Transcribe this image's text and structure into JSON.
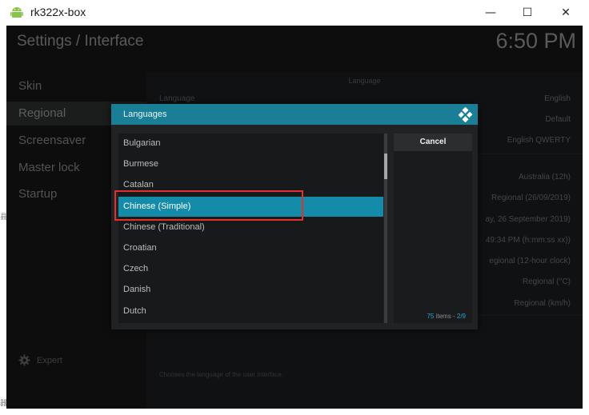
{
  "window": {
    "title": "rk322x-box",
    "minimize_glyph": "—",
    "maximize_glyph": "☐",
    "close_glyph": "✕",
    "app_icon": "android-icon"
  },
  "header": {
    "breadcrumb": "Settings / Interface",
    "clock": "6:50 PM"
  },
  "sidebar": {
    "items": [
      {
        "label": "Skin"
      },
      {
        "label": "Regional"
      },
      {
        "label": "Screensaver"
      },
      {
        "label": "Master lock"
      },
      {
        "label": "Startup"
      }
    ],
    "expert_label": "Expert",
    "expert_icon": "gear-icon"
  },
  "settings": {
    "section_header": "Language",
    "language_label": "Language",
    "language_value": "English",
    "charset_value": "Default",
    "keyboard_value": "English QWERTY",
    "region_value": "Australia (12h)",
    "short_date_value": "Regional (26/09/2019)",
    "long_date_value": "ay, 26 September 2019)",
    "time_format_value": "49:34 PM (h:mm:ss xx))",
    "clock_value": "egional (12-hour clock)",
    "temperature_value": "Regional (°C)",
    "speed_value": "Regional (km/h)",
    "description": "Chooses the language of the user interface."
  },
  "dialog": {
    "title": "Languages",
    "header_icon": "kodi-logo-icon",
    "cancel_label": "Cancel",
    "items": [
      {
        "label": "Bulgarian"
      },
      {
        "label": "Burmese"
      },
      {
        "label": "Catalan"
      },
      {
        "label": "Chinese (Simple)"
      },
      {
        "label": "Chinese (Traditional)"
      },
      {
        "label": "Croatian"
      },
      {
        "label": "Czech"
      },
      {
        "label": "Danish"
      },
      {
        "label": "Dutch"
      }
    ],
    "selected_index": 3,
    "item_count": "75",
    "items_word": "items",
    "page": "2/9",
    "scroll_position": 0.12
  },
  "colors": {
    "accent": "#148ba8",
    "header": "#1a7e96",
    "highlight_box": "#e0312e"
  },
  "edge": {
    "left_char_1": "县",
    "left_char_2": "器"
  }
}
